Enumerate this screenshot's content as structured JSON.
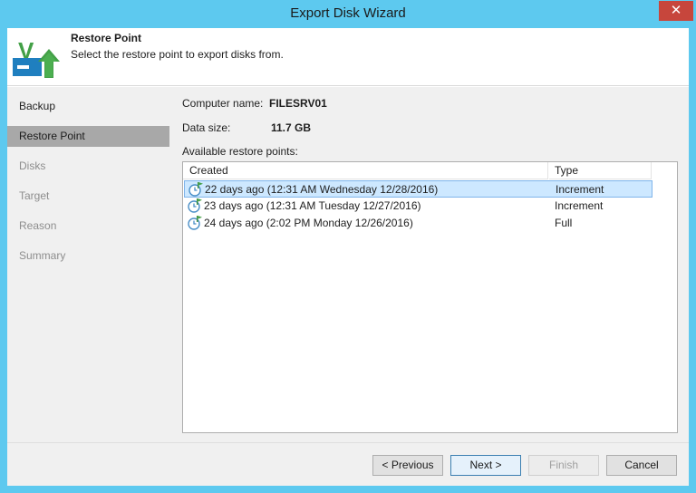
{
  "window": {
    "title": "Export Disk Wizard",
    "close_glyph": "✕",
    "accent": "#5dc9ef"
  },
  "header": {
    "title": "Restore Point",
    "subtitle": "Select the restore point to export disks from.",
    "logo_letter": "V"
  },
  "sidebar": {
    "items": [
      {
        "label": "Backup",
        "state": "done"
      },
      {
        "label": "Restore Point",
        "state": "active"
      },
      {
        "label": "Disks",
        "state": "disabled"
      },
      {
        "label": "Target",
        "state": "disabled"
      },
      {
        "label": "Reason",
        "state": "disabled"
      },
      {
        "label": "Summary",
        "state": "disabled"
      }
    ]
  },
  "main": {
    "computer_name_label": "Computer name:",
    "computer_name_value": "FILESRV01",
    "data_size_label": "Data size:",
    "data_size_value": "11.7 GB",
    "list_label": "Available restore points:",
    "columns": {
      "created": "Created",
      "type": "Type"
    },
    "rows": [
      {
        "created": "22 days ago (12:31 AM Wednesday 12/28/2016)",
        "type": "Increment",
        "selected": true,
        "icon": "restore-point-clock-icon"
      },
      {
        "created": "23 days ago (12:31 AM Tuesday 12/27/2016)",
        "type": "Increment",
        "selected": false,
        "icon": "restore-point-clock-icon"
      },
      {
        "created": "24 days ago (2:02 PM Monday 12/26/2016)",
        "type": "Full",
        "selected": false,
        "icon": "restore-point-clock-icon"
      }
    ]
  },
  "footer": {
    "previous_label": "< Previous",
    "next_label": "Next >",
    "finish_label": "Finish",
    "cancel_label": "Cancel"
  }
}
